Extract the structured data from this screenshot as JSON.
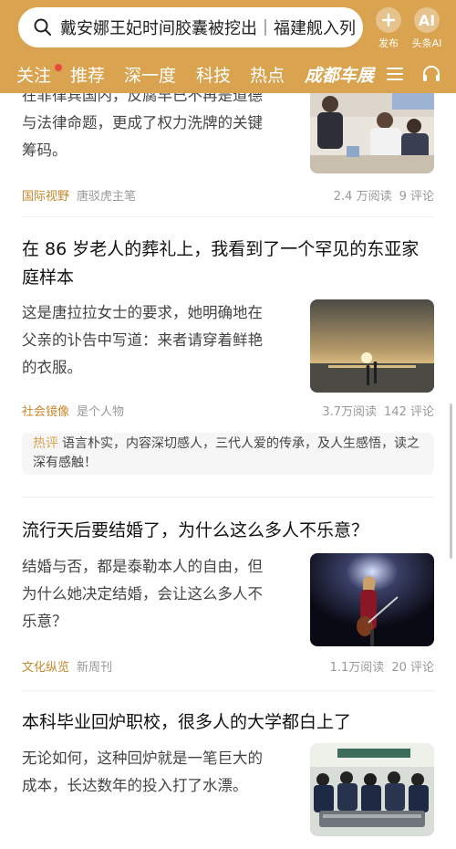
{
  "search": {
    "query": "戴安娜王妃时间胶囊被挖出｜福建舰入列"
  },
  "header": {
    "publish_label": "发布",
    "ai_badge": "AI",
    "ai_label": "头条AI"
  },
  "nav": {
    "tabs": [
      "关注",
      "推荐",
      "深一度",
      "科技",
      "热点"
    ],
    "brand": "成都车展",
    "accent_color": "#d9a34f",
    "dot_color": "#e84a3c"
  },
  "articles": [
    {
      "summary_lines": [
        "在菲律宾国内，反腐早已不再是道德",
        "与法律命题，更成了权力洗牌的关键",
        "筹码。"
      ],
      "channel": "国际视野",
      "source": "唐驳虎主笔",
      "reads": "2.4 万阅读",
      "comments": "9 评论"
    },
    {
      "title_lines": [
        "在 86 岁老人的葬礼上，我看到了一个罕见的东亚家",
        "庭样本"
      ],
      "summary_lines": [
        "这是唐拉拉女士的要求，她明确地在",
        "父亲的讣告中写道：来者请穿着鲜艳",
        "的衣服。"
      ],
      "channel": "社会镜像",
      "source": "是个人物",
      "reads": "3.7万阅读",
      "comments": "142 评论",
      "hot_label": "热评",
      "hot_comment": "语言朴实，内容深切感人，三代人爱的传承，及人生感悟，读之深有感触！"
    },
    {
      "title_lines": [
        "流行天后要结婚了，为什么这么多人不乐意？"
      ],
      "summary_lines": [
        "结婚与否，都是泰勒本人的自由，但",
        "为什么她决定结婚，会让这么多人不",
        "乐意？"
      ],
      "channel": "文化纵览",
      "source": "新周刊",
      "reads": "1.1万阅读",
      "comments": "20 评论"
    },
    {
      "title_lines": [
        "本科毕业回炉职校，很多人的大学都白上了"
      ],
      "summary_lines": [
        "无论如何，这种回炉就是一笔巨大的",
        "成本，长达数年的投入打了水漂。"
      ]
    }
  ]
}
